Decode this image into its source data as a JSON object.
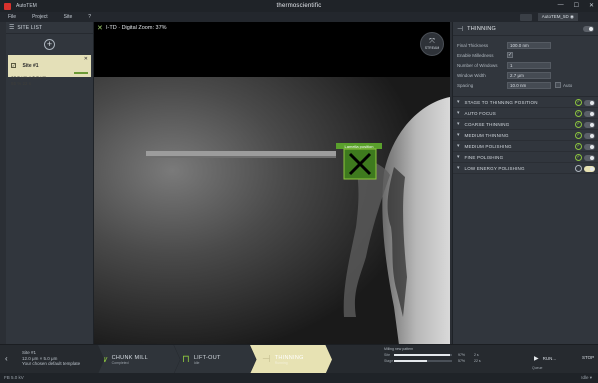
{
  "window": {
    "app_title": "AutoTEM",
    "brand": "thermoscientific",
    "controls": [
      "—",
      "☐",
      "✕"
    ]
  },
  "menu": {
    "items": [
      "File",
      "Project",
      "Site",
      "?"
    ],
    "workspace": "AutoTEM_5D ◉"
  },
  "site_list": {
    "title": "SITE LIST",
    "site": {
      "name": "Site #1",
      "line1": "12.0 μm × 5.0 μm",
      "line2": "55 %   22 s"
    }
  },
  "image_view": {
    "label": "I-TD · Digital Zoom: 37%",
    "stream_label": "STREAM",
    "marker_label": "Lamella position"
  },
  "thinning": {
    "title": "THINNING",
    "enabled": true,
    "fields": [
      {
        "label": "Final Thickness",
        "value": "100.0 nm",
        "type": "input"
      },
      {
        "label": "Enable Milledness",
        "value": "✓",
        "type": "check"
      },
      {
        "label": "Number of Windows",
        "value": "1",
        "type": "input"
      },
      {
        "label": "Window Width",
        "value": "2.7 μm",
        "type": "input"
      },
      {
        "label": "Spacing",
        "value": "10.0 nm",
        "type": "input",
        "auto": "Auto"
      }
    ],
    "steps": [
      {
        "label": "STAGE TO THINNING POSITION",
        "done": true
      },
      {
        "label": "AUTO FOCUS",
        "done": true
      },
      {
        "label": "COARSE THINNING",
        "done": true
      },
      {
        "label": "MEDIUM THINNING",
        "done": true
      },
      {
        "label": "MEDIUM POLISHING",
        "done": true
      },
      {
        "label": "FINE POLISHING",
        "done": true
      },
      {
        "label": "LOW ENERGY POLISHING",
        "done": false
      }
    ]
  },
  "workflow": {
    "site_name": "Site #1",
    "site_size": "12.0 μm × 5.0 μm",
    "site_note": "Your chosen default template",
    "stages": [
      {
        "name": "CHUNK MILL",
        "sub": "Completed"
      },
      {
        "name": "LIFT-OUT",
        "sub": "Idle"
      },
      {
        "name": "THINNING",
        "sub": "Running"
      }
    ],
    "progress": {
      "title": "Milling new pattern",
      "rows": [
        {
          "label": "Site",
          "value": "97%",
          "time": "2 s",
          "fraction": 0.97
        },
        {
          "label": "Stage",
          "value": "57%",
          "time": "22 s",
          "fraction": 0.57
        }
      ]
    },
    "run_label": "RUN...",
    "run_sub": "Queue",
    "stop_label": "STOP"
  },
  "status": {
    "left": "FB 5.0 kV",
    "right": "Idle ▾"
  },
  "colors": {
    "accent_green": "#8dc63f",
    "active_stage": "#e7e2b3",
    "site_card": "#e4e0b8"
  }
}
